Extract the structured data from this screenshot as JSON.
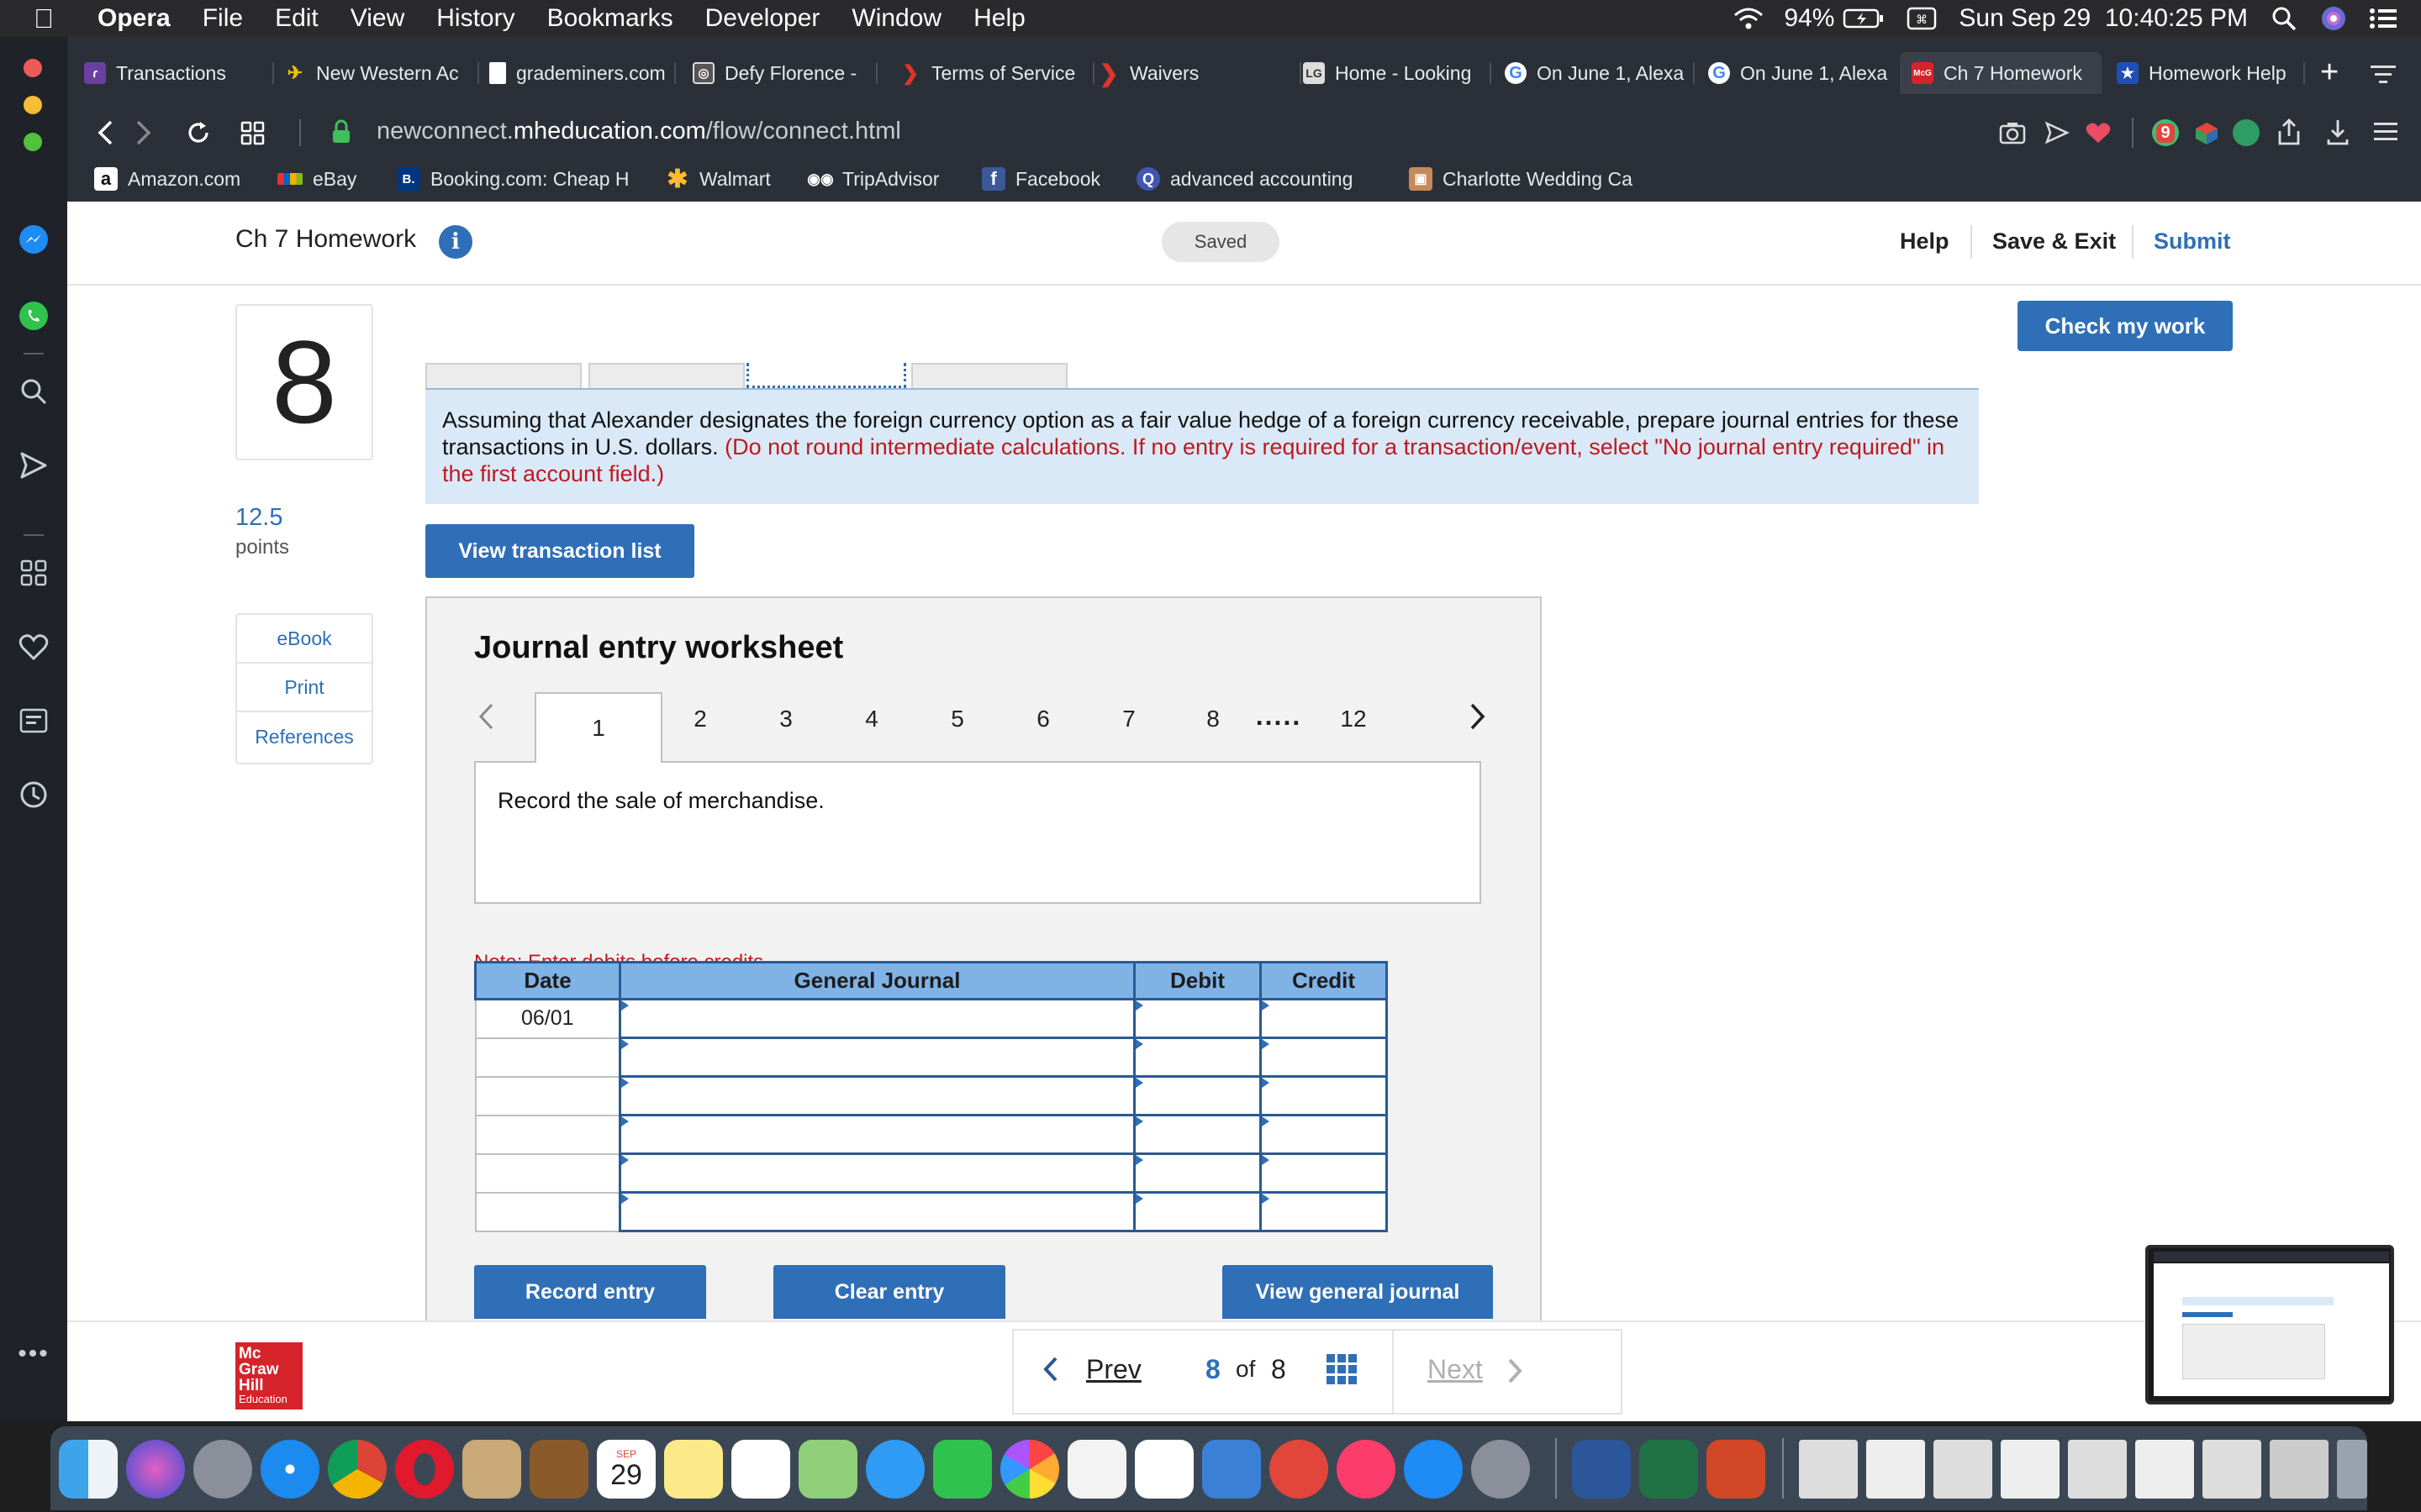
{
  "menubar": {
    "app": "Opera",
    "items": [
      "File",
      "Edit",
      "View",
      "History",
      "Bookmarks",
      "Developer",
      "Window",
      "Help"
    ],
    "battery": "94%",
    "datetime": "Sun Sep 29  10:40:25 PM"
  },
  "tabs": [
    {
      "label": "Transactions",
      "color": "#6b3fa0"
    },
    {
      "label": "New Western Ac",
      "color": "#f2c200"
    },
    {
      "label": "grademiners.com",
      "color": "#ffffff"
    },
    {
      "label": "Defy Florence -",
      "color": "#777777"
    },
    {
      "label": "Terms of Service",
      "color": "#e0342a"
    },
    {
      "label": "Waivers",
      "color": "#e0342a"
    },
    {
      "label": "Home - Looking",
      "color": "#888888"
    },
    {
      "label": "On June 1, Alexa",
      "color": "#4285f4"
    },
    {
      "label": "On June 1, Alexa",
      "color": "#4285f4"
    },
    {
      "label": "Ch 7 Homework",
      "color": "#d6232a"
    },
    {
      "label": "Homework Help",
      "color": "#1f4fb5"
    }
  ],
  "address": {
    "prefix": "newconnect.",
    "domain": "mheducation.com",
    "path": "/flow/connect.html"
  },
  "bookmarks": [
    {
      "label": "Amazon.com",
      "icon": "a"
    },
    {
      "label": "eBay",
      "icon": "e"
    },
    {
      "label": "Booking.com: Cheap H",
      "icon": "B."
    },
    {
      "label": "Walmart",
      "icon": "✱"
    },
    {
      "label": "TripAdvisor",
      "icon": "oo"
    },
    {
      "label": "Facebook",
      "icon": "f"
    },
    {
      "label": "advanced accounting",
      "icon": "Q"
    },
    {
      "label": "Charlotte Wedding Ca",
      "icon": "▣"
    }
  ],
  "header": {
    "title": "Ch 7 Homework",
    "saved": "Saved",
    "help": "Help",
    "save_exit": "Save & Exit",
    "submit": "Submit",
    "check": "Check my work"
  },
  "question": {
    "number": "8",
    "points_value": "12.5",
    "points_label": "points",
    "links": [
      "eBook",
      "Print",
      "References"
    ],
    "instruction": "Assuming that Alexander designates the foreign currency option as a fair value hedge of a foreign currency receivable, prepare journal entries for these transactions in U.S. dollars.",
    "instruction_red": "(Do not round intermediate calculations. If no entry is required for a transaction/event, select \"No journal entry required\" in the first account field.)",
    "view_list": "View transaction list"
  },
  "worksheet": {
    "title": "Journal entry worksheet",
    "tabs": [
      "1",
      "2",
      "3",
      "4",
      "5",
      "6",
      "7",
      "8",
      ".....",
      "12"
    ],
    "prompt": "Record the sale of merchandise.",
    "note": "Note: Enter debits before credits.",
    "columns": [
      "Date",
      "General Journal",
      "Debit",
      "Credit"
    ],
    "rows": [
      {
        "date": "06/01",
        "account": "",
        "debit": "",
        "credit": ""
      },
      {
        "date": "",
        "account": "",
        "debit": "",
        "credit": ""
      },
      {
        "date": "",
        "account": "",
        "debit": "",
        "credit": ""
      },
      {
        "date": "",
        "account": "",
        "debit": "",
        "credit": ""
      },
      {
        "date": "",
        "account": "",
        "debit": "",
        "credit": ""
      },
      {
        "date": "",
        "account": "",
        "debit": "",
        "credit": ""
      }
    ],
    "record": "Record entry",
    "clear": "Clear entry",
    "view_journal": "View general journal"
  },
  "footer": {
    "logo": [
      "Mc",
      "Graw",
      "Hill",
      "Education"
    ],
    "prev": "Prev",
    "current": "8",
    "of": "of",
    "total": "8",
    "next": "Next"
  },
  "dock": {
    "calendar_month": "SEP",
    "calendar_day": "29"
  }
}
